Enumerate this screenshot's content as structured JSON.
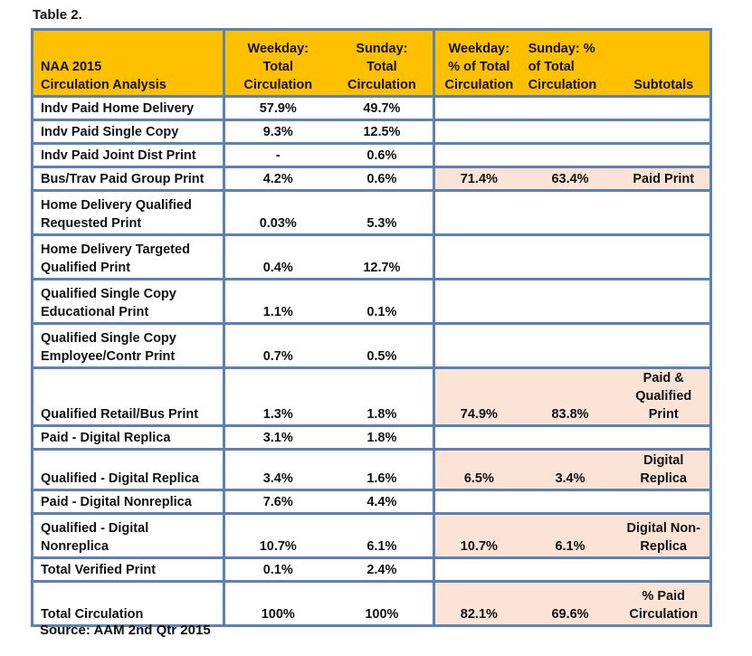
{
  "caption": "Table 2.",
  "source": "Source: AAM 2nd Qtr 2015",
  "colors": {
    "header_bg": "#ffc000",
    "highlight_bg": "#fbe4d5",
    "border": "#5b82b4"
  },
  "table": {
    "headers": {
      "label_line1": "NAA 2015",
      "label_line2": "Circulation Analysis",
      "weekday_total_line1": "Weekday:  Total",
      "weekday_total_line2": "Circulation",
      "sunday_total_line1": "Sunday:",
      "sunday_total_line2": "Total",
      "sunday_total_line3": "Circulation",
      "weekday_pct_line1": "Weekday:",
      "weekday_pct_line2": "% of  Total",
      "weekday_pct_line3": "Circulation",
      "sunday_pct_line1": "Sunday: %",
      "sunday_pct_line2": "of Total",
      "sunday_pct_line3": "Circulation",
      "subtotals": "Subtotals"
    },
    "rows": [
      {
        "label": [
          "Indv Paid Home Delivery"
        ],
        "weekday": "57.9%",
        "sunday": "49.7%",
        "weekday_pct": "",
        "sunday_pct": "",
        "subtotal": []
      },
      {
        "label": [
          "Indv Paid Single Copy"
        ],
        "weekday": "9.3%",
        "sunday": "12.5%",
        "weekday_pct": "",
        "sunday_pct": "",
        "subtotal": []
      },
      {
        "label": [
          "Indv Paid Joint Dist Print"
        ],
        "weekday": "-",
        "sunday": "0.6%",
        "weekday_pct": "",
        "sunday_pct": "",
        "subtotal": []
      },
      {
        "label": [
          "Bus/Trav Paid Group Print"
        ],
        "weekday": "4.2%",
        "sunday": "0.6%",
        "weekday_pct": "71.4%",
        "sunday_pct": "63.4%",
        "subtotal": [
          "Paid Print"
        ]
      },
      {
        "label": [
          "Home Delivery Qualified",
          "Requested  Print"
        ],
        "weekday": "0.03%",
        "sunday": "5.3%",
        "weekday_pct": "",
        "sunday_pct": "",
        "subtotal": []
      },
      {
        "label": [
          "Home Delivery Targeted",
          "Qualified Print"
        ],
        "weekday": "0.4%",
        "sunday": "12.7%",
        "weekday_pct": "",
        "sunday_pct": "",
        "subtotal": []
      },
      {
        "label": [
          "Qualified Single Copy",
          "Educational Print"
        ],
        "weekday": "1.1%",
        "sunday": "0.1%",
        "weekday_pct": "",
        "sunday_pct": "",
        "subtotal": []
      },
      {
        "label": [
          "Qualified Single Copy",
          "Employee/Contr Print"
        ],
        "weekday": "0.7%",
        "sunday": "0.5%",
        "weekday_pct": "",
        "sunday_pct": "",
        "subtotal": []
      },
      {
        "label": [
          "Qualified Retail/Bus Print"
        ],
        "weekday": "1.3%",
        "sunday": "1.8%",
        "weekday_pct": "74.9%",
        "sunday_pct": "83.8%",
        "subtotal": [
          "Paid &",
          "Qualified",
          "Print"
        ]
      },
      {
        "label": [
          "Paid - Digital Replica"
        ],
        "weekday": "3.1%",
        "sunday": "1.8%",
        "weekday_pct": "",
        "sunday_pct": "",
        "subtotal": []
      },
      {
        "label": [
          "Qualified - Digital Replica"
        ],
        "weekday": "3.4%",
        "sunday": "1.6%",
        "weekday_pct": "6.5%",
        "sunday_pct": "3.4%",
        "subtotal": [
          "Digital",
          "Replica"
        ]
      },
      {
        "label": [
          "Paid - Digital Nonreplica"
        ],
        "weekday": "7.6%",
        "sunday": "4.4%",
        "weekday_pct": "",
        "sunday_pct": "",
        "subtotal": []
      },
      {
        "label": [
          "Qualified - Digital Nonreplica"
        ],
        "weekday": "10.7%",
        "sunday": "6.1%",
        "weekday_pct": "10.7%",
        "sunday_pct": "6.1%",
        "subtotal": [
          "Digital Non-",
          "Replica"
        ]
      },
      {
        "label": [
          "Total Verified Print"
        ],
        "weekday": "0.1%",
        "sunday": "2.4%",
        "weekday_pct": "",
        "sunday_pct": "",
        "subtotal": []
      },
      {
        "label": [
          "Total Circulation"
        ],
        "weekday": "100%",
        "sunday": "100%",
        "weekday_pct": "82.1%",
        "sunday_pct": "69.6%",
        "subtotal": [
          "% Paid",
          "Circulation"
        ]
      }
    ]
  }
}
